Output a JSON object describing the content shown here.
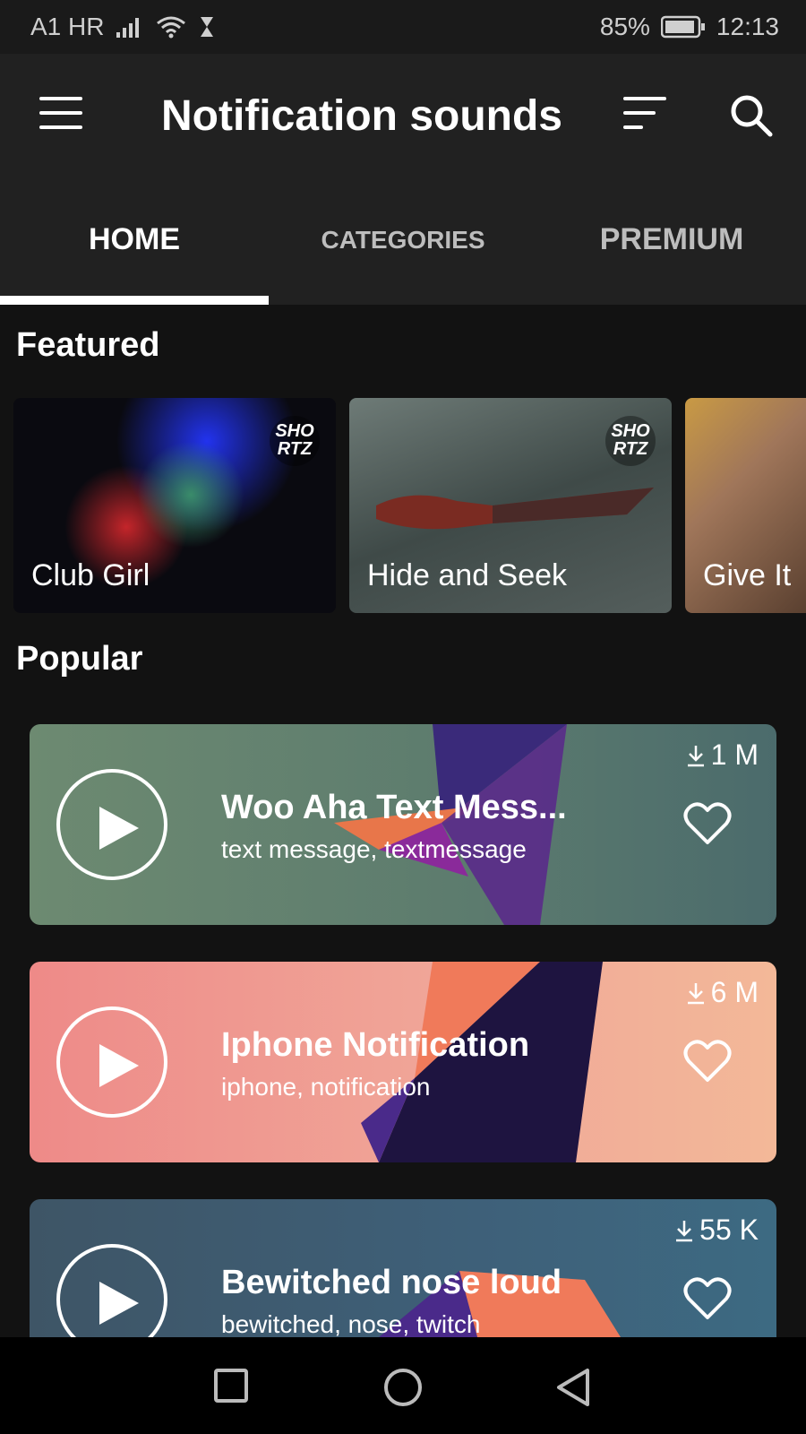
{
  "status_bar": {
    "carrier": "A1 HR",
    "battery": "85%",
    "time": "12:13"
  },
  "app_bar": {
    "title": "Notification sounds",
    "icons": [
      "menu-icon",
      "sort-icon",
      "search-icon"
    ]
  },
  "tabs": [
    {
      "label": "HOME",
      "active": true
    },
    {
      "label": "CATEGORIES",
      "active": false
    },
    {
      "label": "PREMIUM",
      "active": false
    }
  ],
  "featured": {
    "title": "Featured",
    "items": [
      {
        "label": "Club Girl",
        "badge": "SHO RTZ"
      },
      {
        "label": "Hide and Seek",
        "badge": "SHO RTZ"
      },
      {
        "label": "Give It"
      }
    ]
  },
  "popular": {
    "title": "Popular",
    "items": [
      {
        "name": "Woo Aha Text Mess...",
        "tags": "text message, textmessage",
        "downloads": "1 M"
      },
      {
        "name": "Iphone Notification",
        "tags": "iphone, notification",
        "downloads": "6 M"
      },
      {
        "name": "Bewitched nose loud",
        "tags": "bewitched, nose, twitch",
        "downloads": "55 K"
      }
    ]
  },
  "nav_bar": {
    "icons": [
      "recents-square-icon",
      "home-circle-icon",
      "back-triangle-icon"
    ]
  }
}
